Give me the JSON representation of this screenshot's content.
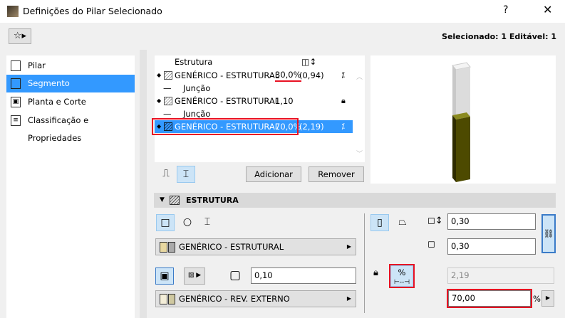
{
  "window": {
    "title": "Definições do Pilar Selecionado",
    "help": "?",
    "close": "✕"
  },
  "toolbar": {
    "favorites_icon": "favorites-icon",
    "selection_info": "Selecionado: 1 Editável: 1"
  },
  "sidebar": {
    "items": [
      {
        "label": "Pilar"
      },
      {
        "label": "Segmento",
        "selected": true
      },
      {
        "label": "Planta e Corte"
      },
      {
        "label": "Classificação e Propriedades"
      }
    ]
  },
  "segments": {
    "header_name": "Estrutura",
    "header_icon": "height-icon",
    "rows": [
      {
        "name": "GENÉRICO - ESTRUTURAL",
        "value": "30,0%",
        "extra": "(0,94)",
        "icon": "proportional-icon"
      },
      {
        "junction": "Junção"
      },
      {
        "name": "GENÉRICO - ESTRUTURAL",
        "value": "1,10",
        "extra": "",
        "icon": "locked-icon"
      },
      {
        "junction": "Junção"
      },
      {
        "name": "GENÉRICO - ESTRUTURAL",
        "value": "70,0%",
        "extra": "(2,19)",
        "icon": "proportional-icon",
        "selected": true
      }
    ],
    "add": "Adicionar",
    "remove": "Remover"
  },
  "section": {
    "title": "ESTRUTURA"
  },
  "structure": {
    "material": "GENÉRICO - ESTRUTURAL",
    "veneer_thickness": "0,10",
    "veneer_material": "GENÉRICO - REV. EXTERNO",
    "width": "0,30",
    "depth": "0,30",
    "height_computed": "2,19",
    "percent": "70,00",
    "percent_unit": "%",
    "percent_btn": "%"
  },
  "colors": {
    "accent": "#3399ff",
    "highlight": "#e81123",
    "column_top": "#d8d8d8",
    "column_bottom": "#4d4a00"
  }
}
